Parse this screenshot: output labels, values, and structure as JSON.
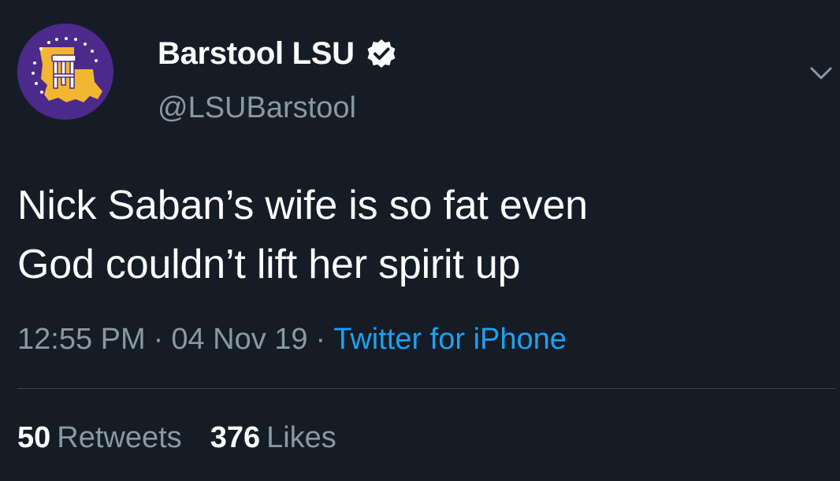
{
  "tweet": {
    "display_name": "Barstool LSU",
    "handle": "@LSUBarstool",
    "verified": true,
    "text_lines": [
      "Nick Saban’s wife is so fat even",
      "God couldn’t lift her spirit up"
    ],
    "time": "12:55 PM",
    "date": "04 Nov 19",
    "separator": "·",
    "source": "Twitter for iPhone",
    "retweets": {
      "count": "50",
      "label": "Retweets"
    },
    "likes": {
      "count": "376",
      "label": "Likes"
    }
  },
  "icons": {
    "avatar": "barstool-lsu-logo-icon",
    "verified": "verified-badge-icon",
    "menu": "chevron-down-icon"
  },
  "colors": {
    "background": "#151c26",
    "primary_text": "#ffffff",
    "secondary_text": "#8899a6",
    "link": "#1da1f2",
    "divider": "#38444d",
    "avatar_purple": "#4b2a8c",
    "avatar_gold": "#f2b632"
  }
}
